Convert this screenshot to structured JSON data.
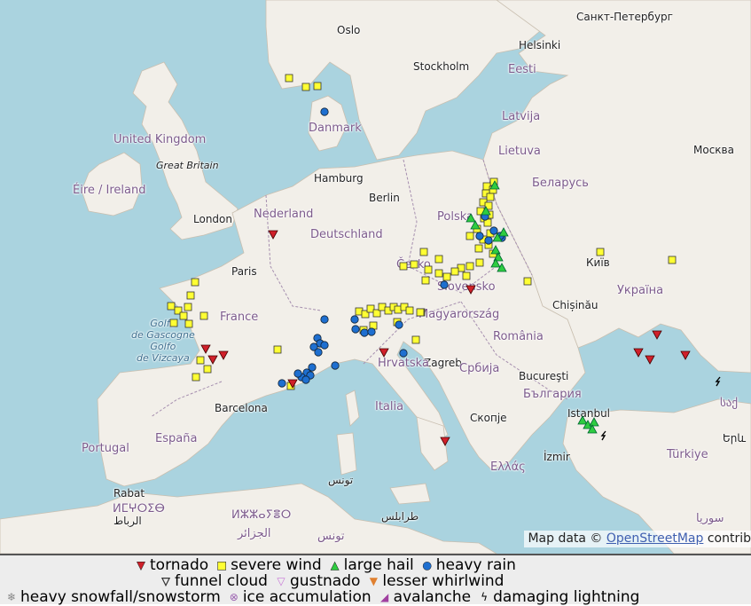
{
  "map": {
    "places": [
      {
        "name": "Oslo",
        "kind": "city"
      },
      {
        "name": "Stockholm",
        "kind": "city"
      },
      {
        "name": "Helsinki",
        "kind": "city"
      },
      {
        "name": "Санкт-Петербург",
        "kind": "city"
      },
      {
        "name": "Eesti",
        "kind": "country"
      },
      {
        "name": "Latvija",
        "kind": "country"
      },
      {
        "name": "Lietuva",
        "kind": "country"
      },
      {
        "name": "Москва",
        "kind": "city"
      },
      {
        "name": "Danmark",
        "kind": "country"
      },
      {
        "name": "United Kingdom",
        "kind": "country"
      },
      {
        "name": "Great Britain",
        "kind": "region"
      },
      {
        "name": "Éire / Ireland",
        "kind": "country"
      },
      {
        "name": "London",
        "kind": "city"
      },
      {
        "name": "Hamburg",
        "kind": "city"
      },
      {
        "name": "Berlin",
        "kind": "city"
      },
      {
        "name": "Беларусь",
        "kind": "country"
      },
      {
        "name": "Nederland",
        "kind": "country"
      },
      {
        "name": "Deutschland",
        "kind": "country"
      },
      {
        "name": "Polska",
        "kind": "country"
      },
      {
        "name": "Paris",
        "kind": "city"
      },
      {
        "name": "Česko",
        "kind": "country"
      },
      {
        "name": "Київ",
        "kind": "city"
      },
      {
        "name": "Slovensko",
        "kind": "country"
      },
      {
        "name": "Україна",
        "kind": "country"
      },
      {
        "name": "France",
        "kind": "country"
      },
      {
        "name": "Chișinău",
        "kind": "city"
      },
      {
        "name": "Magyarország",
        "kind": "country"
      },
      {
        "name": "Golfe de Gascogne / Golfo de Vizcaya",
        "kind": "sea"
      },
      {
        "name": "România",
        "kind": "country"
      },
      {
        "name": "Zagreb",
        "kind": "city"
      },
      {
        "name": "Hrvatska",
        "kind": "country"
      },
      {
        "name": "Србија",
        "kind": "country"
      },
      {
        "name": "Bucureşti",
        "kind": "city"
      },
      {
        "name": "Barcelona",
        "kind": "city"
      },
      {
        "name": "България",
        "kind": "country"
      },
      {
        "name": "Italia",
        "kind": "country"
      },
      {
        "name": "España",
        "kind": "country"
      },
      {
        "name": "Istanbul",
        "kind": "city"
      },
      {
        "name": "Скопје",
        "kind": "city"
      },
      {
        "name": "Portugal",
        "kind": "country"
      },
      {
        "name": "İzmir",
        "kind": "city"
      },
      {
        "name": "Türkiye",
        "kind": "country"
      },
      {
        "name": "Ελλάς",
        "kind": "country"
      },
      {
        "name": "Rabat",
        "kind": "city"
      },
      {
        "name": "ⵍⵎⵖⵔⵉⴱ",
        "kind": "country"
      },
      {
        "name": "الرباط",
        "kind": "city"
      },
      {
        "name": "تونس",
        "kind": "city"
      },
      {
        "name": "ⵍⵣⵣⴰⵢⴻⵔ",
        "kind": "country"
      },
      {
        "name": "الجزائر",
        "kind": "country"
      },
      {
        "name": "تونس",
        "kind": "country"
      },
      {
        "name": "طرابلس",
        "kind": "city"
      },
      {
        "name": "سوريا",
        "kind": "country"
      },
      {
        "name": "Երև",
        "kind": "city"
      },
      {
        "name": "საქ",
        "kind": "country"
      }
    ],
    "attribution": {
      "prefix": "Map data ©",
      "link": "OpenStreetMap",
      "suffix": "contrib"
    },
    "colors": {
      "water": "#aad3df",
      "land": "#f2efe9",
      "border": "#a68faf",
      "tornado": "#d0202a",
      "wind": "#ffff33",
      "hail": "#2ecc40",
      "rain": "#1e6fd0"
    },
    "reports": {
      "tornado": [
        [
          308,
          264
        ],
        [
          232,
          393
        ],
        [
          240,
          405
        ],
        [
          252,
          400
        ],
        [
          330,
          432
        ],
        [
          433,
          397
        ],
        [
          531,
          326
        ],
        [
          502,
          497
        ],
        [
          741,
          377
        ],
        [
          720,
          397
        ],
        [
          733,
          405
        ],
        [
          773,
          400
        ]
      ],
      "severe_wind": [
        [
          326,
          88
        ],
        [
          345,
          98
        ],
        [
          358,
          97
        ],
        [
          557,
          205
        ],
        [
          549,
          210
        ],
        [
          556,
          214
        ],
        [
          548,
          218
        ],
        [
          553,
          222
        ],
        [
          545,
          228
        ],
        [
          551,
          232
        ],
        [
          542,
          238
        ],
        [
          552,
          242
        ],
        [
          546,
          246
        ],
        [
          550,
          251
        ],
        [
          538,
          258
        ],
        [
          553,
          263
        ],
        [
          530,
          266
        ],
        [
          545,
          270
        ],
        [
          551,
          276
        ],
        [
          540,
          280
        ],
        [
          556,
          286
        ],
        [
          541,
          296
        ],
        [
          530,
          300
        ],
        [
          520,
          302
        ],
        [
          513,
          306
        ],
        [
          526,
          311
        ],
        [
          495,
          292
        ],
        [
          478,
          284
        ],
        [
          467,
          298
        ],
        [
          483,
          304
        ],
        [
          495,
          308
        ],
        [
          504,
          312
        ],
        [
          480,
          316
        ],
        [
          455,
          300
        ],
        [
          475,
          352
        ],
        [
          595,
          317
        ],
        [
          677,
          284
        ],
        [
          758,
          293
        ],
        [
          220,
          318
        ],
        [
          215,
          333
        ],
        [
          193,
          345
        ],
        [
          201,
          350
        ],
        [
          212,
          346
        ],
        [
          207,
          356
        ],
        [
          230,
          356
        ],
        [
          196,
          364
        ],
        [
          213,
          365
        ],
        [
          313,
          394
        ],
        [
          226,
          406
        ],
        [
          234,
          416
        ],
        [
          221,
          425
        ],
        [
          328,
          435
        ],
        [
          405,
          351
        ],
        [
          412,
          354
        ],
        [
          418,
          348
        ],
        [
          425,
          353
        ],
        [
          431,
          346
        ],
        [
          438,
          350
        ],
        [
          444,
          346
        ],
        [
          449,
          349
        ],
        [
          456,
          346
        ],
        [
          462,
          350
        ],
        [
          474,
          352
        ],
        [
          410,
          372
        ],
        [
          421,
          367
        ],
        [
          448,
          363
        ],
        [
          469,
          383
        ]
      ],
      "large_hail": [
        [
          558,
          209
        ],
        [
          548,
          238
        ],
        [
          531,
          246
        ],
        [
          536,
          254
        ],
        [
          568,
          262
        ],
        [
          561,
          268
        ],
        [
          559,
          282
        ],
        [
          562,
          290
        ],
        [
          559,
          297
        ],
        [
          566,
          302
        ],
        [
          657,
          474
        ],
        [
          663,
          479
        ],
        [
          670,
          476
        ],
        [
          668,
          484
        ]
      ],
      "heavy_rain": [
        [
          366,
          126
        ],
        [
          547,
          244
        ],
        [
          557,
          260
        ],
        [
          541,
          266
        ],
        [
          551,
          271
        ],
        [
          566,
          268
        ],
        [
          501,
          321
        ],
        [
          366,
          360
        ],
        [
          358,
          381
        ],
        [
          361,
          387
        ],
        [
          354,
          391
        ],
        [
          366,
          389
        ],
        [
          359,
          397
        ],
        [
          352,
          414
        ],
        [
          346,
          420
        ],
        [
          340,
          425
        ],
        [
          350,
          423
        ],
        [
          345,
          428
        ],
        [
          336,
          421
        ],
        [
          318,
          432
        ],
        [
          378,
          412
        ],
        [
          400,
          360
        ],
        [
          401,
          371
        ],
        [
          411,
          375
        ],
        [
          419,
          374
        ],
        [
          450,
          366
        ],
        [
          455,
          398
        ],
        [
          564,
          266
        ]
      ],
      "lightning": [
        [
          810,
          430
        ],
        [
          681,
          491
        ]
      ]
    }
  },
  "legend": {
    "row1": [
      {
        "icon": "tornado-icon",
        "label": "tornado",
        "color": "#d0202a"
      },
      {
        "icon": "square-icon",
        "label": "severe wind",
        "color": "#ffff33"
      },
      {
        "icon": "triangle-icon",
        "label": "large hail",
        "color": "#2ecc40"
      },
      {
        "icon": "circle-icon",
        "label": "heavy rain",
        "color": "#1e6fd0"
      }
    ],
    "row2": [
      {
        "icon": "funnel-icon",
        "label": "funnel cloud",
        "color": "#ffffff"
      },
      {
        "icon": "gustnado-icon",
        "label": "gustnado",
        "color": "#c878d8"
      },
      {
        "icon": "whirlwind-icon",
        "label": "lesser whirlwind",
        "color": "#e08030"
      }
    ],
    "row3": [
      {
        "icon": "snowflake-icon",
        "label": "heavy snowfall/snowstorm",
        "color": "#888888"
      },
      {
        "icon": "ice-icon",
        "label": "ice accumulation",
        "color": "#9a60b0"
      },
      {
        "icon": "avalanche-icon",
        "label": "avalanche",
        "color": "#a040a0"
      },
      {
        "icon": "lightning-icon",
        "label": "damaging lightning",
        "color": "#000000"
      }
    ]
  }
}
